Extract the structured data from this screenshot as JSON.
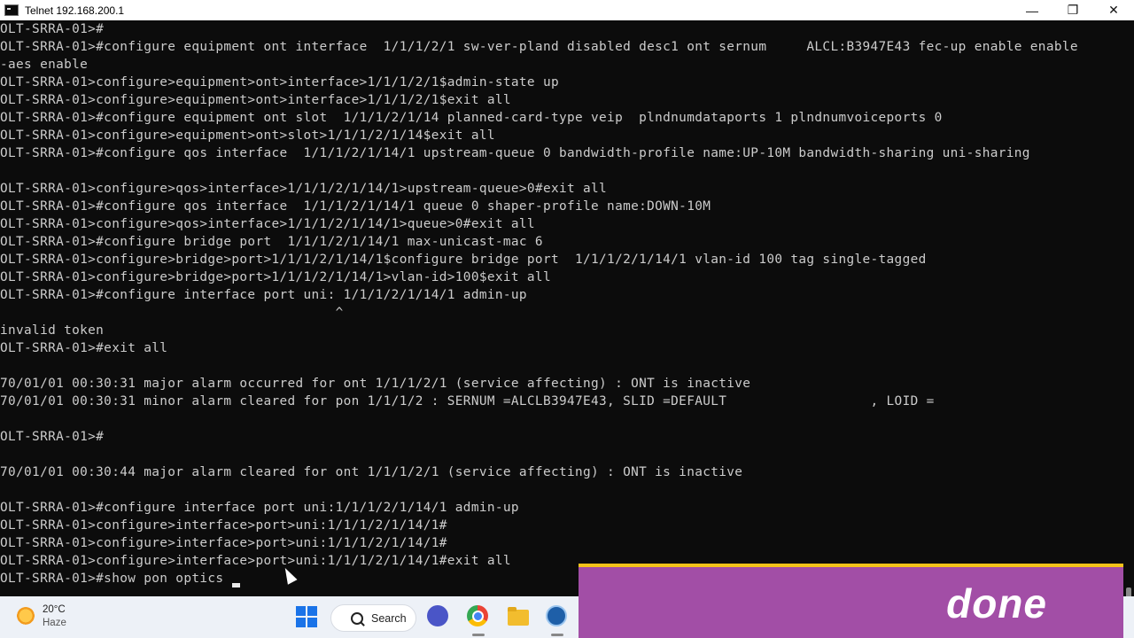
{
  "window": {
    "title": "Telnet 192.168.200.1",
    "minimize_glyph": "—",
    "maximize_glyph": "❐",
    "close_glyph": "✕"
  },
  "terminal": {
    "lines": [
      "OLT-SRRA-01>#",
      "OLT-SRRA-01>#configure equipment ont interface  1/1/1/2/1 sw-ver-pland disabled desc1 ont sernum     ALCL:B3947E43 fec-up enable enable",
      "-aes enable",
      "OLT-SRRA-01>configure>equipment>ont>interface>1/1/1/2/1$admin-state up",
      "OLT-SRRA-01>configure>equipment>ont>interface>1/1/1/2/1$exit all",
      "OLT-SRRA-01>#configure equipment ont slot  1/1/1/2/1/14 planned-card-type veip  plndnumdataports 1 plndnumvoiceports 0",
      "OLT-SRRA-01>configure>equipment>ont>slot>1/1/1/2/1/14$exit all",
      "OLT-SRRA-01>#configure qos interface  1/1/1/2/1/14/1 upstream-queue 0 bandwidth-profile name:UP-10M bandwidth-sharing uni-sharing",
      "",
      "OLT-SRRA-01>configure>qos>interface>1/1/1/2/1/14/1>upstream-queue>0#exit all",
      "OLT-SRRA-01>#configure qos interface  1/1/1/2/1/14/1 queue 0 shaper-profile name:DOWN-10M",
      "OLT-SRRA-01>configure>qos>interface>1/1/1/2/1/14/1>queue>0#exit all",
      "OLT-SRRA-01>#configure bridge port  1/1/1/2/1/14/1 max-unicast-mac 6",
      "OLT-SRRA-01>configure>bridge>port>1/1/1/2/1/14/1$configure bridge port  1/1/1/2/1/14/1 vlan-id 100 tag single-tagged",
      "OLT-SRRA-01>configure>bridge>port>1/1/1/2/1/14/1>vlan-id>100$exit all",
      "OLT-SRRA-01>#configure interface port uni: 1/1/1/2/1/14/1 admin-up",
      "                                          ^",
      "invalid token",
      "OLT-SRRA-01>#exit all",
      "",
      "70/01/01 00:30:31 major alarm occurred for ont 1/1/1/2/1 (service affecting) : ONT is inactive",
      "70/01/01 00:30:31 minor alarm cleared for pon 1/1/1/2 : SERNUM =ALCLB3947E43, SLID =DEFAULT                  , LOID =",
      "",
      "OLT-SRRA-01>#",
      "",
      "70/01/01 00:30:44 major alarm cleared for ont 1/1/1/2/1 (service affecting) : ONT is inactive",
      "",
      "OLT-SRRA-01>#configure interface port uni:1/1/1/2/1/14/1 admin-up",
      "OLT-SRRA-01>configure>interface>port>uni:1/1/1/2/1/14/1#",
      "OLT-SRRA-01>configure>interface>port>uni:1/1/1/2/1/14/1#",
      "OLT-SRRA-01>configure>interface>port>uni:1/1/1/2/1/14/1#exit all",
      "OLT-SRRA-01>#show pon optics "
    ]
  },
  "taskbar": {
    "temperature": "20°C",
    "condition": "Haze",
    "search_label": "Search",
    "icons": [
      "start-icon",
      "search-icon",
      "meet-icon",
      "chrome-icon",
      "file-explorer-icon",
      "telnet-app-icon"
    ]
  },
  "overlay": {
    "text": "done",
    "background": "#a24ea6",
    "border_color": "#f4c21a"
  },
  "colors": {
    "terminal_bg": "#0c0c0c",
    "terminal_fg": "#cccccc"
  }
}
